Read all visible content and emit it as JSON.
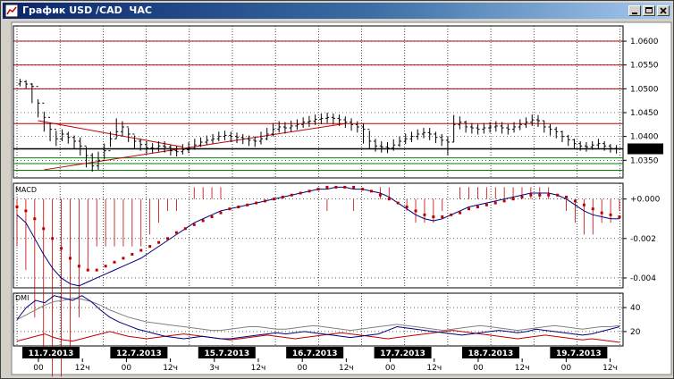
{
  "window": {
    "title": "График USD /CAD  ЧАС"
  },
  "colors": {
    "title_gradient_start": "#0a246a",
    "title_gradient_end": "#a6caf0",
    "grid": "#000000",
    "price_bar": "#000000",
    "resistance_line": "#c00000",
    "support_line": "#008000",
    "trend_line": "#c00000",
    "current_price_line": "#000000",
    "macd_line": "#000080",
    "signal_dots": "#c00000",
    "histogram": "#c00000",
    "dmi_plus": "#000080",
    "dmi_minus": "#c00000",
    "adx": "#808080"
  },
  "price_panel": {
    "y_ticks": [
      "1.0600",
      "1.0550",
      "1.0500",
      "1.0450",
      "1.0400",
      "1.0350"
    ],
    "current_price": "1.0374",
    "ylim": [
      1.0313,
      1.0632
    ],
    "red_horizontal_levels": [
      1.06,
      1.055,
      1.05,
      1.0427
    ],
    "green_horizontal_levels": [
      1.0355,
      1.0343,
      1.0329
    ],
    "current_level": 1.0374,
    "trend_lines": [
      {
        "from": [
          3,
          1.0433
        ],
        "to": [
          27,
          1.0378
        ]
      },
      {
        "from": [
          4,
          1.033
        ],
        "to": [
          54,
          1.0427
        ]
      }
    ]
  },
  "macd_panel": {
    "label": "MACD",
    "y_ticks": [
      "+0.000",
      "-0.002",
      "-0.004"
    ],
    "ylim": [
      -0.0045,
      0.0008
    ]
  },
  "dmi_panel": {
    "label": "DMI",
    "y_ticks": [
      "40",
      "20"
    ],
    "ylim": [
      8,
      52
    ]
  },
  "time_axis": {
    "dates": [
      "11.7.2013",
      "12.7.2013",
      "15.7.2013",
      "16.7.2013",
      "17.7.2013",
      "18.7.2013",
      "19.7.2013"
    ],
    "hour_ticks": [
      {
        "label": "00",
        "day": 0
      },
      {
        "label": "12ч",
        "day": 0.5
      },
      {
        "label": "00",
        "day": 1
      },
      {
        "label": "12ч",
        "day": 1.5
      },
      {
        "label": "3ч",
        "day": 2
      },
      {
        "label": "12ч",
        "day": 2.5
      },
      {
        "label": "00",
        "day": 3
      },
      {
        "label": "12ч",
        "day": 3.5
      },
      {
        "label": "00",
        "day": 4
      },
      {
        "label": "12ч",
        "day": 4.5
      },
      {
        "label": "00",
        "day": 5
      },
      {
        "label": "12ч",
        "day": 5.5
      },
      {
        "label": "00",
        "day": 6
      },
      {
        "label": "12ч",
        "day": 6.5
      }
    ]
  },
  "chart_data": {
    "type": "ohlc",
    "title": "График USD /CAD  ЧАС",
    "x_unit": "hour bars",
    "price": {
      "close": [
        1.0515,
        1.051,
        1.0505,
        1.047,
        1.044,
        1.0415,
        1.0395,
        1.0405,
        1.0398,
        1.039,
        1.038,
        1.036,
        1.0338,
        1.035,
        1.037,
        1.0395,
        1.041,
        1.042,
        1.0405,
        1.039,
        1.0383,
        1.0376,
        1.0375,
        1.038,
        1.0378,
        1.037,
        1.0368,
        1.0372,
        1.0375,
        1.0382,
        1.0388,
        1.0392,
        1.0395,
        1.04,
        1.0402,
        1.04,
        1.0398,
        1.0395,
        1.0392,
        1.039,
        1.0395,
        1.0405,
        1.0415,
        1.042,
        1.0418,
        1.0422,
        1.0425,
        1.043,
        1.0432,
        1.0436,
        1.0438,
        1.044,
        1.0438,
        1.0435,
        1.043,
        1.0425,
        1.042,
        1.0415,
        1.039,
        1.038,
        1.0378,
        1.0376,
        1.0382,
        1.039,
        1.0395,
        1.04,
        1.0405,
        1.0408,
        1.0405,
        1.0398,
        1.0392,
        1.0388,
        1.0425,
        1.043,
        1.042,
        1.0418,
        1.0415,
        1.0418,
        1.042,
        1.0422,
        1.0418,
        1.0415,
        1.042,
        1.0425,
        1.043,
        1.0435,
        1.0433,
        1.042,
        1.0415,
        1.041,
        1.04,
        1.0393,
        1.0385,
        1.038,
        1.0378,
        1.0382,
        1.0385,
        1.038,
        1.0375,
        1.0374
      ],
      "high": [
        1.0521,
        1.0518,
        1.0512,
        1.0478,
        1.0452,
        1.0428,
        1.0412,
        1.0415,
        1.041,
        1.0402,
        1.0398,
        1.0378,
        1.0365,
        1.0368,
        1.0385,
        1.041,
        1.0438,
        1.0432,
        1.0418,
        1.0402,
        1.0395,
        1.039,
        1.0386,
        1.039,
        1.039,
        1.0382,
        1.038,
        1.0384,
        1.0388,
        1.0395,
        1.0398,
        1.0402,
        1.0405,
        1.041,
        1.0412,
        1.041,
        1.0408,
        1.0405,
        1.0402,
        1.04,
        1.041,
        1.0418,
        1.0428,
        1.0432,
        1.043,
        1.0433,
        1.0436,
        1.044,
        1.0443,
        1.0446,
        1.0448,
        1.045,
        1.0448,
        1.0446,
        1.0442,
        1.0438,
        1.0432,
        1.0428,
        1.0412,
        1.0395,
        1.039,
        1.0388,
        1.0394,
        1.04,
        1.0406,
        1.041,
        1.0415,
        1.0418,
        1.0418,
        1.041,
        1.0405,
        1.04,
        1.0445,
        1.0442,
        1.0433,
        1.0428,
        1.0426,
        1.0428,
        1.043,
        1.0432,
        1.043,
        1.0426,
        1.043,
        1.0436,
        1.044,
        1.0446,
        1.0445,
        1.0433,
        1.0426,
        1.042,
        1.0412,
        1.0403,
        1.0395,
        1.039,
        1.0388,
        1.039,
        1.0395,
        1.039,
        1.0384,
        1.0382
      ],
      "low": [
        1.0505,
        1.05,
        1.047,
        1.044,
        1.041,
        1.039,
        1.038,
        1.039,
        1.0385,
        1.0375,
        1.036,
        1.0335,
        1.0326,
        1.033,
        1.0352,
        1.0378,
        1.0395,
        1.04,
        1.0388,
        1.0375,
        1.037,
        1.0364,
        1.0365,
        1.0368,
        1.0366,
        1.036,
        1.0358,
        1.0362,
        1.0365,
        1.0372,
        1.0378,
        1.0382,
        1.0385,
        1.039,
        1.0392,
        1.0388,
        1.0386,
        1.0384,
        1.038,
        1.0378,
        1.0383,
        1.0392,
        1.04,
        1.0408,
        1.0406,
        1.041,
        1.0414,
        1.0418,
        1.042,
        1.0424,
        1.0426,
        1.0428,
        1.0425,
        1.0422,
        1.0418,
        1.0412,
        1.0408,
        1.0385,
        1.0375,
        1.0368,
        1.0366,
        1.0365,
        1.037,
        1.0378,
        1.0384,
        1.0388,
        1.0393,
        1.0396,
        1.0392,
        1.0386,
        1.038,
        1.036,
        1.0388,
        1.0415,
        1.0408,
        1.0406,
        1.0404,
        1.0406,
        1.0408,
        1.041,
        1.0406,
        1.0404,
        1.0408,
        1.0413,
        1.0418,
        1.0422,
        1.042,
        1.0408,
        1.0402,
        1.0396,
        1.0388,
        1.038,
        1.0373,
        1.037,
        1.0368,
        1.0372,
        1.0375,
        1.037,
        1.0366,
        1.0364
      ],
      "open": [
        1.051,
        1.0515,
        1.051,
        1.0505,
        1.047,
        1.044,
        1.0415,
        1.0395,
        1.0405,
        1.0398,
        1.039,
        1.038,
        1.036,
        1.0338,
        1.035,
        1.037,
        1.0395,
        1.041,
        1.042,
        1.0405,
        1.039,
        1.0383,
        1.0376,
        1.0375,
        1.038,
        1.0378,
        1.037,
        1.0368,
        1.0372,
        1.0375,
        1.0382,
        1.0388,
        1.0392,
        1.0395,
        1.04,
        1.0402,
        1.04,
        1.0398,
        1.0395,
        1.0392,
        1.039,
        1.0395,
        1.0405,
        1.0415,
        1.042,
        1.0418,
        1.0422,
        1.0425,
        1.043,
        1.0432,
        1.0436,
        1.0438,
        1.044,
        1.0438,
        1.0435,
        1.043,
        1.0425,
        1.042,
        1.0415,
        1.039,
        1.038,
        1.0378,
        1.0376,
        1.0382,
        1.039,
        1.0395,
        1.04,
        1.0405,
        1.0408,
        1.0405,
        1.0398,
        1.0392,
        1.0388,
        1.0425,
        1.043,
        1.042,
        1.0418,
        1.0415,
        1.0418,
        1.042,
        1.0422,
        1.0418,
        1.0415,
        1.042,
        1.0425,
        1.043,
        1.0435,
        1.0433,
        1.042,
        1.0415,
        1.041,
        1.04,
        1.0393,
        1.0385,
        1.038,
        1.0378,
        1.0382,
        1.0385,
        1.038,
        1.0375
      ]
    },
    "macd": [
      -0.0008,
      -0.0012,
      -0.002,
      -0.0028,
      -0.0035,
      -0.004,
      -0.0043,
      -0.0044,
      -0.0042,
      -0.004,
      -0.0038,
      -0.0036,
      -0.0034,
      -0.0032,
      -0.003,
      -0.0027,
      -0.0024,
      -0.0021,
      -0.0018,
      -0.0015,
      -0.0012,
      -0.001,
      -0.0008,
      -0.0006,
      -0.0005,
      -0.0004,
      -0.0003,
      -0.0002,
      -0.0001,
      0.0,
      0.0001,
      0.0002,
      0.0003,
      0.0004,
      0.0005,
      0.0005,
      0.0006,
      0.0006,
      0.0005,
      0.0005,
      0.0004,
      0.0003,
      0.0001,
      -0.0002,
      -0.0005,
      -0.0008,
      -0.001,
      -0.0011,
      -0.001,
      -0.0008,
      -0.0006,
      -0.0004,
      -0.0003,
      -0.0002,
      -0.0001,
      0.0,
      0.0001,
      0.0002,
      0.0003,
      0.0003,
      0.0003,
      0.0002,
      0.0,
      -0.0003,
      -0.0006,
      -0.0008,
      -0.0009,
      -0.001,
      -0.001
    ],
    "signal": [
      -0.0004,
      -0.0006,
      -0.001,
      -0.0015,
      -0.002,
      -0.0025,
      -0.003,
      -0.0034,
      -0.0036,
      -0.0036,
      -0.0034,
      -0.0032,
      -0.003,
      -0.0028,
      -0.0026,
      -0.0024,
      -0.0022,
      -0.002,
      -0.0017,
      -0.0015,
      -0.0013,
      -0.0011,
      -0.0009,
      -0.0007,
      -0.0005,
      -0.0004,
      -0.0003,
      -0.0002,
      -0.0001,
      0.0,
      0.0001,
      0.0002,
      0.0003,
      0.0004,
      0.0005,
      0.0006,
      0.0006,
      0.0006,
      0.0006,
      0.0005,
      0.0004,
      0.0002,
      0.0,
      -0.0002,
      -0.0004,
      -0.0006,
      -0.0008,
      -0.0009,
      -0.0009,
      -0.0008,
      -0.0007,
      -0.0005,
      -0.0004,
      -0.0003,
      -0.0002,
      -0.0001,
      0.0,
      0.0001,
      0.0002,
      0.0002,
      0.0002,
      0.0002,
      0.0001,
      -0.0001,
      -0.0003,
      -0.0005,
      -0.0007,
      -0.0008,
      -0.0009
    ],
    "dmi_plus": [
      30,
      40,
      46,
      44,
      50,
      48,
      46,
      50,
      45,
      38,
      32,
      28,
      25,
      22,
      20,
      18,
      16,
      15,
      14,
      15,
      16,
      15,
      14,
      14,
      15,
      16,
      17,
      18,
      19,
      18,
      19,
      20,
      19,
      18,
      17,
      16,
      15,
      16,
      17,
      18,
      21,
      24,
      23,
      22,
      21,
      20,
      19,
      18,
      17,
      18,
      19,
      20,
      21,
      20,
      19,
      20,
      22,
      21,
      20,
      19,
      18,
      17,
      18,
      20,
      22,
      24
    ],
    "dmi_minus": [
      12,
      14,
      16,
      18,
      15,
      13,
      12,
      14,
      16,
      18,
      20,
      18,
      16,
      15,
      14,
      15,
      16,
      17,
      18,
      17,
      16,
      15,
      14,
      13,
      14,
      15,
      16,
      17,
      16,
      15,
      14,
      15,
      16,
      17,
      18,
      19,
      18,
      17,
      16,
      15,
      14,
      15,
      16,
      17,
      18,
      19,
      20,
      21,
      20,
      19,
      18,
      17,
      16,
      15,
      14,
      15,
      16,
      17,
      16,
      15,
      14,
      13,
      14,
      13,
      12,
      11
    ],
    "adx": [
      30,
      34,
      38,
      42,
      45,
      46,
      48,
      47,
      45,
      42,
      38,
      35,
      32,
      30,
      28,
      27,
      26,
      25,
      24,
      23,
      22,
      21,
      21,
      22,
      23,
      24,
      24,
      23,
      22,
      22,
      23,
      24,
      25,
      24,
      23,
      22,
      21,
      22,
      23,
      24,
      25,
      26,
      25,
      24,
      23,
      22,
      21,
      22,
      23,
      24,
      25,
      24,
      23,
      22,
      21,
      22,
      23,
      24,
      25,
      24,
      23,
      22,
      23,
      24,
      24,
      25
    ]
  }
}
